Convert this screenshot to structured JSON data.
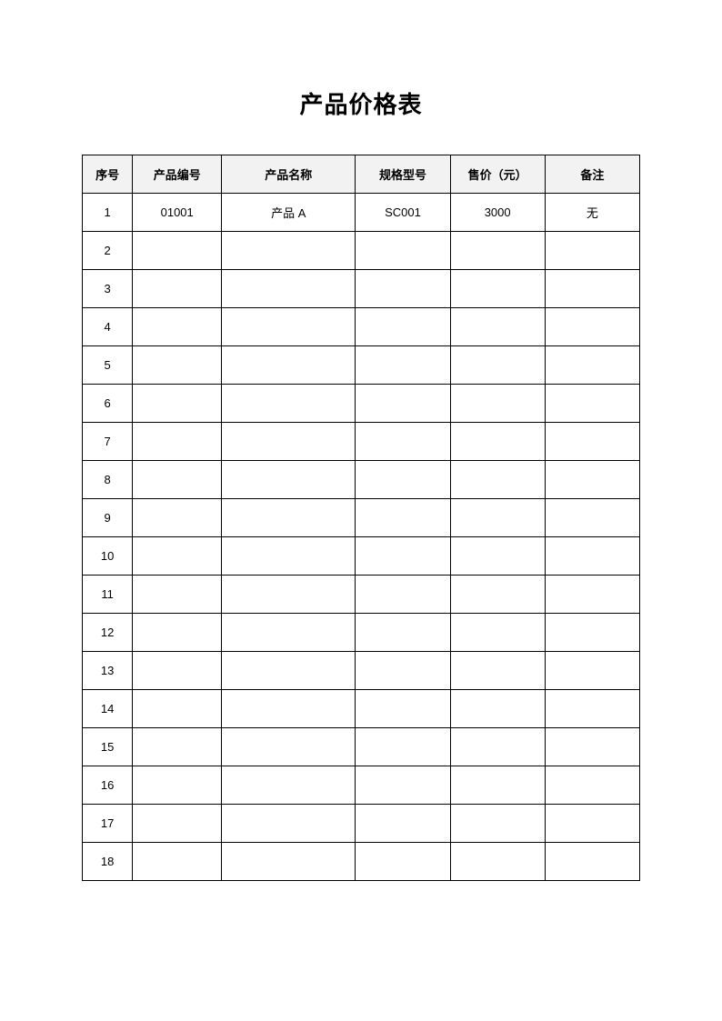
{
  "title": "产品价格表",
  "headers": [
    "序号",
    "产品编号",
    "产品名称",
    "规格型号",
    "售价（元）",
    "备注"
  ],
  "rows": [
    {
      "seq": "1",
      "code": "01001",
      "name": "产品 A",
      "spec": "SC001",
      "price": "3000",
      "remark": "无"
    },
    {
      "seq": "2",
      "code": "",
      "name": "",
      "spec": "",
      "price": "",
      "remark": ""
    },
    {
      "seq": "3",
      "code": "",
      "name": "",
      "spec": "",
      "price": "",
      "remark": ""
    },
    {
      "seq": "4",
      "code": "",
      "name": "",
      "spec": "",
      "price": "",
      "remark": ""
    },
    {
      "seq": "5",
      "code": "",
      "name": "",
      "spec": "",
      "price": "",
      "remark": ""
    },
    {
      "seq": "6",
      "code": "",
      "name": "",
      "spec": "",
      "price": "",
      "remark": ""
    },
    {
      "seq": "7",
      "code": "",
      "name": "",
      "spec": "",
      "price": "",
      "remark": ""
    },
    {
      "seq": "8",
      "code": "",
      "name": "",
      "spec": "",
      "price": "",
      "remark": ""
    },
    {
      "seq": "9",
      "code": "",
      "name": "",
      "spec": "",
      "price": "",
      "remark": ""
    },
    {
      "seq": "10",
      "code": "",
      "name": "",
      "spec": "",
      "price": "",
      "remark": ""
    },
    {
      "seq": "11",
      "code": "",
      "name": "",
      "spec": "",
      "price": "",
      "remark": ""
    },
    {
      "seq": "12",
      "code": "",
      "name": "",
      "spec": "",
      "price": "",
      "remark": ""
    },
    {
      "seq": "13",
      "code": "",
      "name": "",
      "spec": "",
      "price": "",
      "remark": ""
    },
    {
      "seq": "14",
      "code": "",
      "name": "",
      "spec": "",
      "price": "",
      "remark": ""
    },
    {
      "seq": "15",
      "code": "",
      "name": "",
      "spec": "",
      "price": "",
      "remark": ""
    },
    {
      "seq": "16",
      "code": "",
      "name": "",
      "spec": "",
      "price": "",
      "remark": ""
    },
    {
      "seq": "17",
      "code": "",
      "name": "",
      "spec": "",
      "price": "",
      "remark": ""
    },
    {
      "seq": "18",
      "code": "",
      "name": "",
      "spec": "",
      "price": "",
      "remark": ""
    }
  ]
}
